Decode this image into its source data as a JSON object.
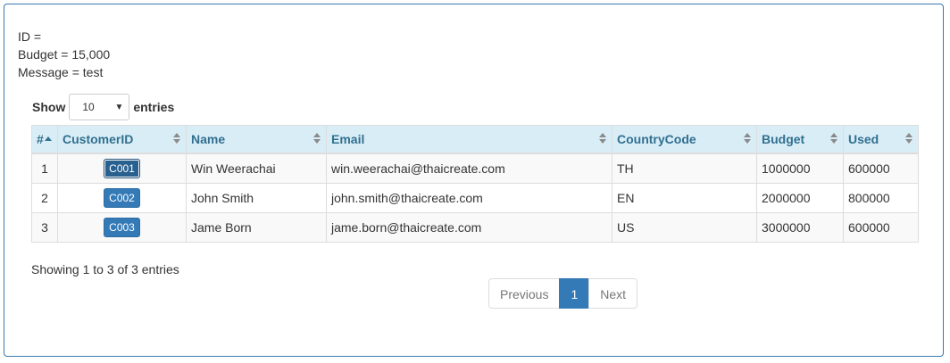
{
  "info": {
    "id_line": "ID =",
    "budget_line": "Budget = 15,000",
    "message_line": "Message = test"
  },
  "length": {
    "show_label": "Show",
    "value": "10",
    "entries_label": "entries"
  },
  "table": {
    "columns": [
      "#",
      "CustomerID",
      "Name",
      "Email",
      "CountryCode",
      "Budget",
      "Used"
    ],
    "rows": [
      {
        "num": "1",
        "cid": "C001",
        "name": "Win Weerachai",
        "email": "win.weerachai@thaicreate.com",
        "country": "TH",
        "budget": "1000000",
        "used": "600000"
      },
      {
        "num": "2",
        "cid": "C002",
        "name": "John Smith",
        "email": "john.smith@thaicreate.com",
        "country": "EN",
        "budget": "2000000",
        "used": "800000"
      },
      {
        "num": "3",
        "cid": "C003",
        "name": "Jame Born",
        "email": "jame.born@thaicreate.com",
        "country": "US",
        "budget": "3000000",
        "used": "600000"
      }
    ]
  },
  "footer": {
    "info": "Showing 1 to 3 of 3 entries",
    "previous": "Previous",
    "current_page": "1",
    "next": "Next"
  },
  "colors": {
    "header_bg": "#d9edf7",
    "header_text": "#31708f",
    "button": "#337ab7",
    "frame": "#3b78b0"
  },
  "icons": {
    "sort": "sort-both-icon",
    "sort_asc": "sort-asc-icon",
    "select_caret": "caret-down-icon"
  }
}
